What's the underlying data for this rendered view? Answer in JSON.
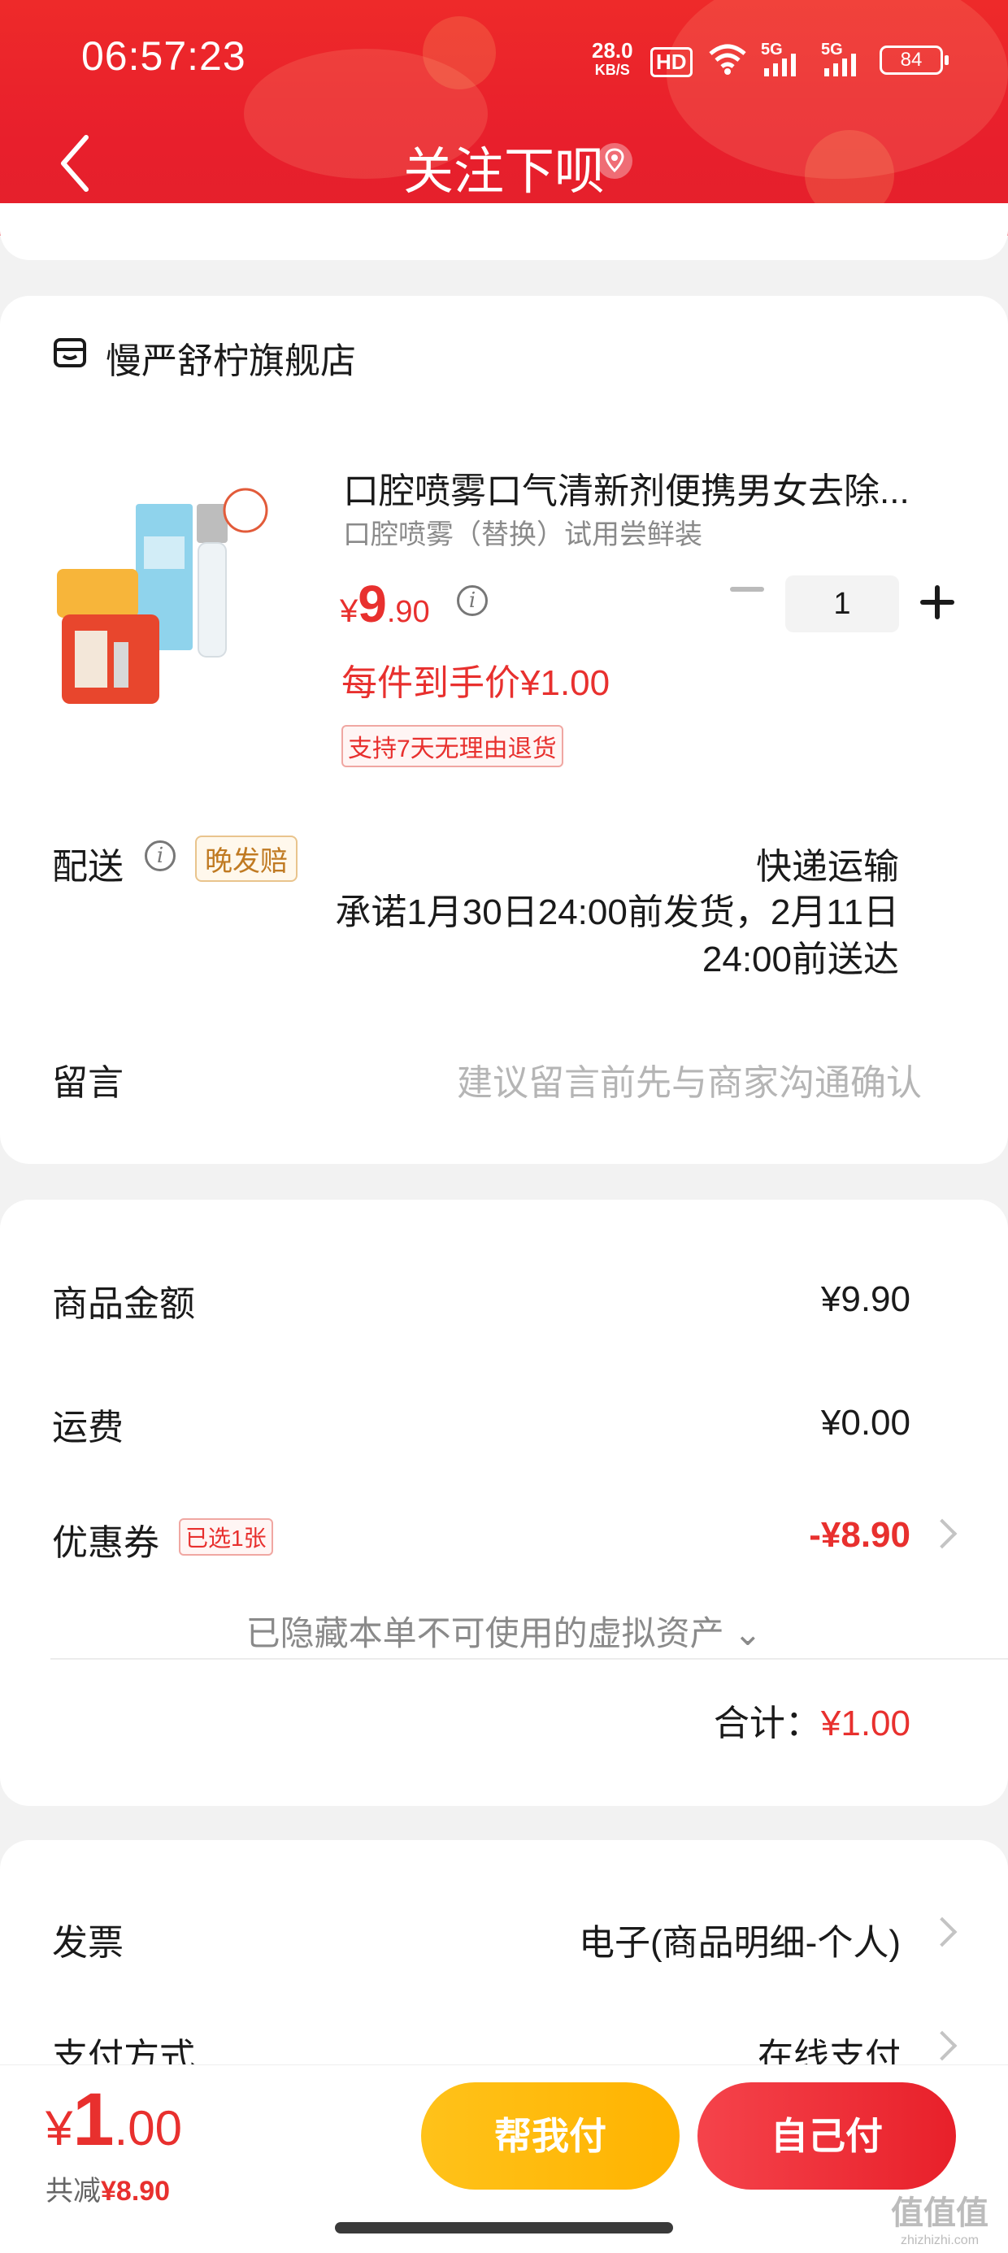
{
  "status_bar": {
    "time": "06:57:23",
    "net_speed": "28.0",
    "net_unit": "KB/S",
    "hd": "HD",
    "sig1": "5G",
    "sig2": "5G",
    "battery": "84"
  },
  "header": {
    "title": "关注下呗"
  },
  "store": {
    "name": "慢严舒柠旗舰店"
  },
  "product": {
    "name": "口腔喷雾口气清新剂便携男女去除...",
    "sku": "口腔喷雾（替换）试用尝鲜装",
    "price_symbol": "¥",
    "price_int": "9",
    "price_dec": ".90",
    "quantity": "1",
    "unit_price_text": "每件到手价¥1.00",
    "return_tag": "支持7天无理由退货"
  },
  "delivery": {
    "label": "配送",
    "late_tag": "晚发赔",
    "method": "快递运输",
    "promise": "承诺1月30日24:00前发货，2月11日 24:00前送达"
  },
  "message": {
    "label": "留言",
    "placeholder": "建议留言前先与商家沟通确认"
  },
  "summary": {
    "goods_label": "商品金额",
    "goods_value": "¥9.90",
    "shipping_label": "运费",
    "shipping_value": "¥0.00",
    "coupon_label": "优惠券",
    "coupon_tag": "已选1张",
    "coupon_value": "-¥8.90",
    "hidden_note": "已隐藏本单不可使用的虚拟资产 ⌄",
    "total_label": "合计：",
    "total_value": "¥1.00"
  },
  "invoice": {
    "label": "发票",
    "value": "电子(商品明细-个人)"
  },
  "payment": {
    "label": "支付方式",
    "value": "在线支付"
  },
  "bottom_bar": {
    "price_symbol": "¥",
    "price_int": "1",
    "price_dec": ".00",
    "save_label": "共减",
    "save_value": "¥8.90",
    "help_pay": "帮我付",
    "self_pay": "自己付"
  },
  "watermark": {
    "main": "值值值",
    "sub": "zhizhizhi.com"
  },
  "colors": {
    "accent_red": "#e8302e",
    "header_red": "#e81f2c",
    "help_yellow": "#ffb300"
  }
}
